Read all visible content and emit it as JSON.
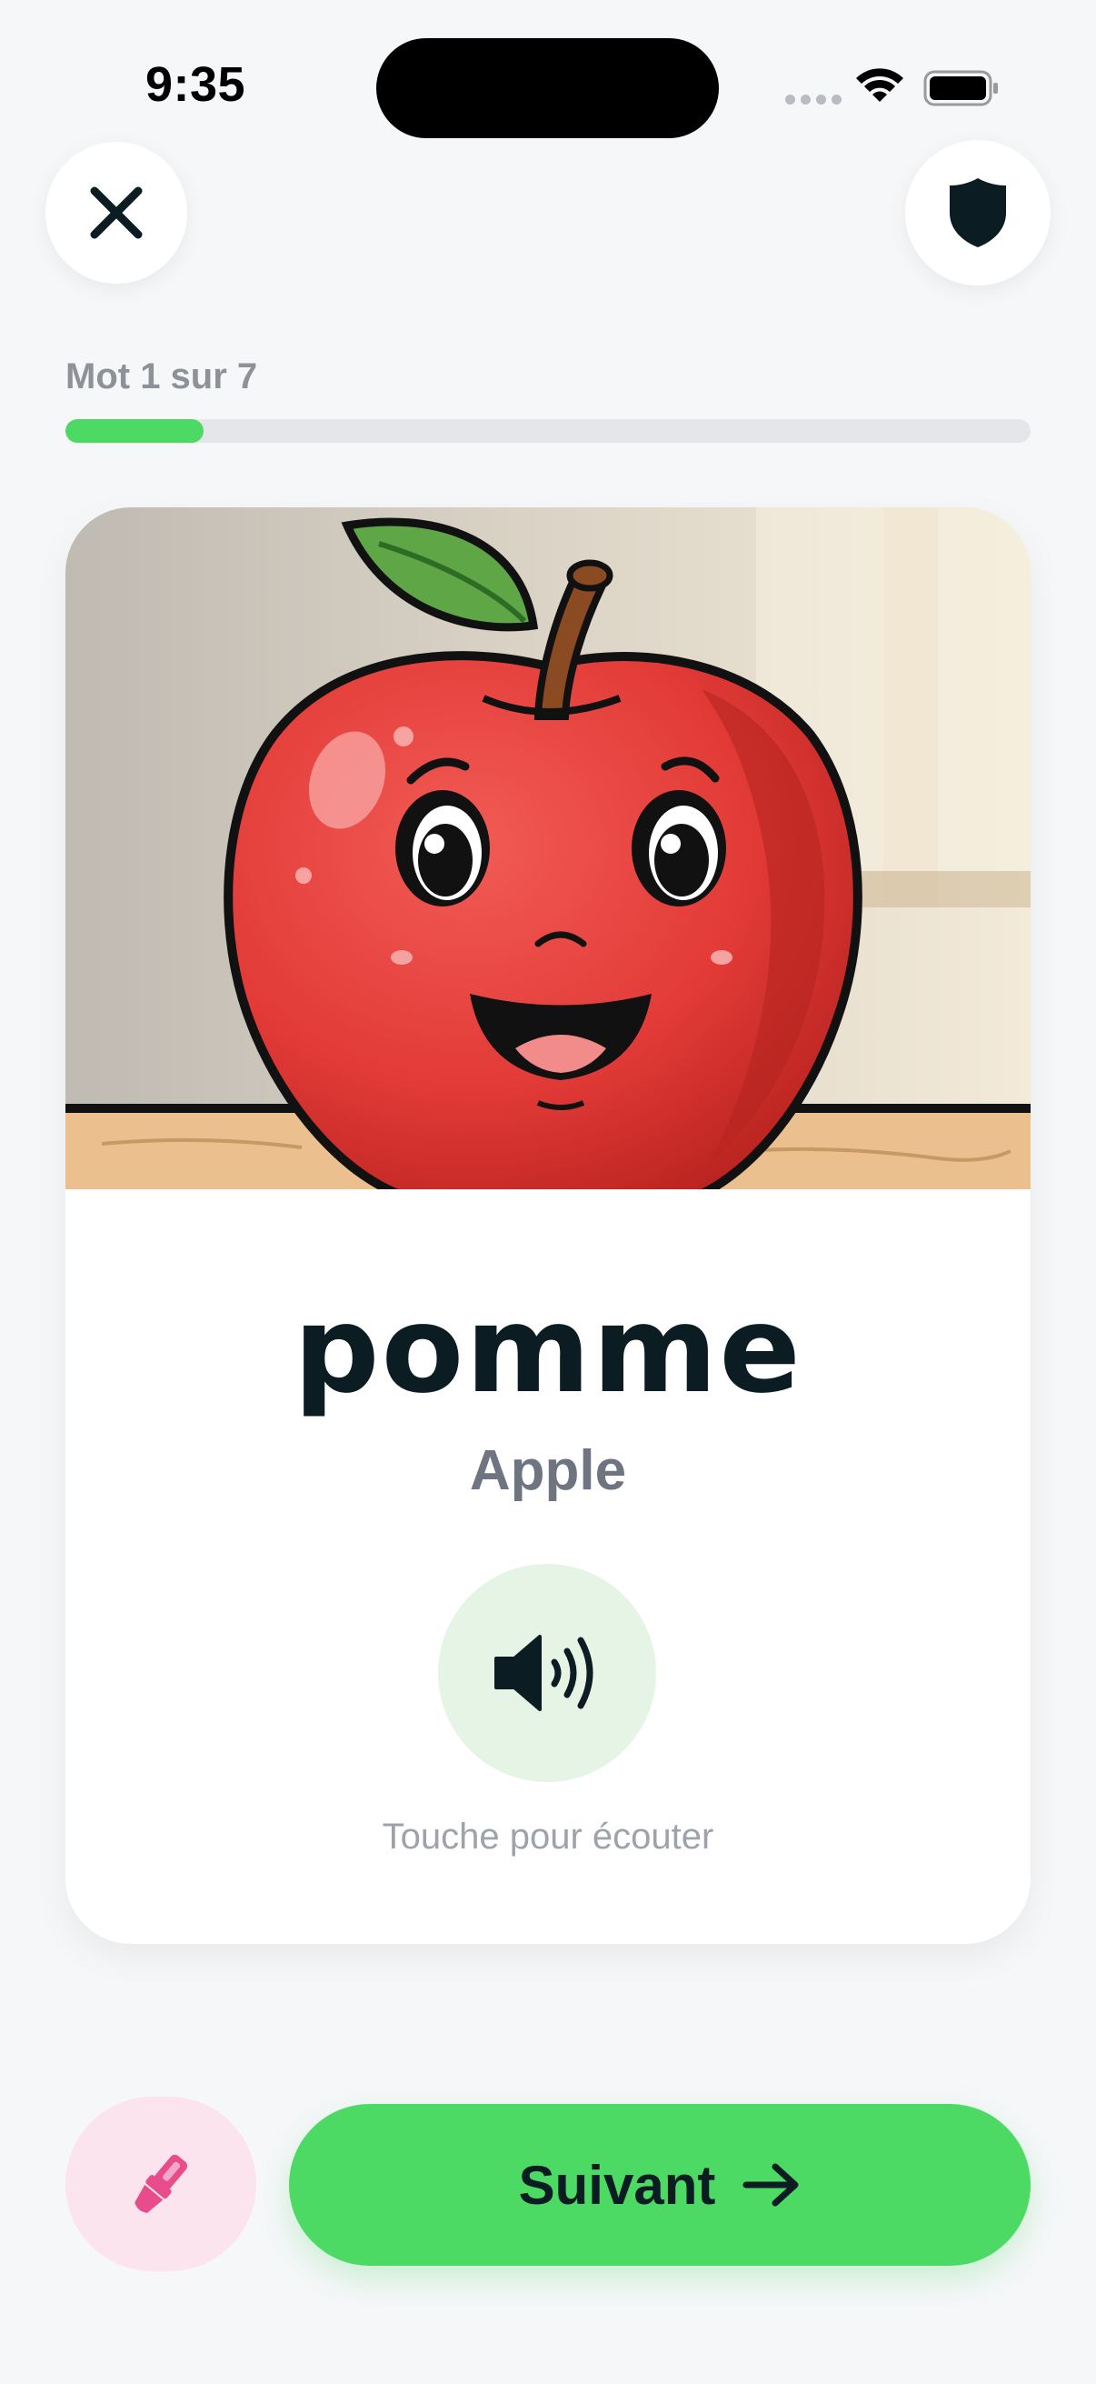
{
  "status_bar": {
    "time": "9:35"
  },
  "top_bar": {
    "close_icon": "close-icon",
    "shield_icon": "shield-icon"
  },
  "progress": {
    "label": "Mot 1 sur 7",
    "current": 1,
    "total": 7,
    "fraction": 0.143
  },
  "card": {
    "image_icon": "apple-illustration",
    "word": "pomme",
    "translation": "Apple",
    "audio_icon": "speaker-icon",
    "audio_hint": "Touche pour écouter"
  },
  "actions": {
    "brush_icon": "paintbrush-icon",
    "next_label": "Suivant",
    "next_icon": "arrow-right-icon"
  },
  "colors": {
    "accent": "#4CD964",
    "brush_bg": "#FCE4EE",
    "brush_icon": "#E84C8A",
    "audio_bg": "#E6F4E6",
    "text_dark": "#0B1D22"
  }
}
